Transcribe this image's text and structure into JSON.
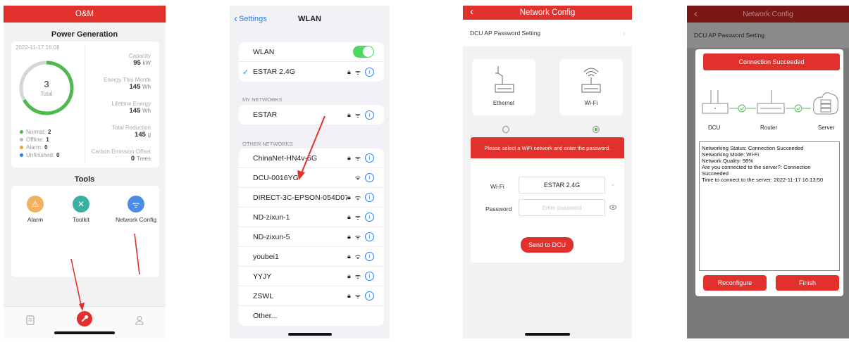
{
  "colors": {
    "accent": "#e2302c",
    "green": "#4cbb4c",
    "blue": "#2a7ef0"
  },
  "screen1": {
    "header": "O&M",
    "power_title": "Power Generation",
    "timestamp": "2022-11-17 16:08",
    "donut": {
      "value": "3",
      "label": "Total",
      "normal_fraction": 0.67
    },
    "stats": [
      {
        "label": "Capacity",
        "value": "95",
        "unit": "kW"
      },
      {
        "label": "Energy This Month",
        "value": "145",
        "unit": "Wh"
      },
      {
        "label": "Lifetime Energy",
        "value": "145",
        "unit": "Wh"
      },
      {
        "label": "Total Reduction",
        "value": "145",
        "unit": "g"
      },
      {
        "label": "Carbon Emission Offset",
        "value": "0",
        "unit": "Trees"
      }
    ],
    "legend": [
      {
        "label": "Normal:",
        "value": "2",
        "color": "#4cbb4c"
      },
      {
        "label": "Offline:",
        "value": "1",
        "color": "#bbbbbb"
      },
      {
        "label": "Alarm:",
        "value": "0",
        "color": "#f0a030"
      },
      {
        "label": "Unfinished:",
        "value": "0",
        "color": "#3a7be0"
      }
    ],
    "tools_title": "Tools",
    "tools": [
      {
        "label": "Alarm",
        "icon": "alarm-icon",
        "color": "#f2b15c"
      },
      {
        "label": "Toolkit",
        "icon": "toolkit-icon",
        "color": "#3ab0a0"
      },
      {
        "label": "Network Config",
        "icon": "network-config-icon",
        "color": "#4a8de6"
      }
    ],
    "tabbar": [
      "report-icon",
      "tools-wrench-icon",
      "profile-icon"
    ]
  },
  "screen2": {
    "back_label": "Settings",
    "title": "WLAN",
    "wlan_label": "WLAN",
    "connected": "ESTAR 2.4G",
    "my_networks_label": "MY NETWORKS",
    "my_networks": [
      "ESTAR"
    ],
    "other_networks_label": "OTHER NETWORKS",
    "other_networks": [
      {
        "name": "ChinaNet-HN4v-5G",
        "locked": true
      },
      {
        "name": "DCU-0016YG",
        "locked": false
      },
      {
        "name": "DIRECT-3C-EPSON-054D07",
        "locked": true
      },
      {
        "name": "ND-zixun-1",
        "locked": true
      },
      {
        "name": "ND-zixun-5",
        "locked": true
      },
      {
        "name": "youbei1",
        "locked": true
      },
      {
        "name": "YYJY",
        "locked": true
      },
      {
        "name": "ZSWL",
        "locked": true
      }
    ],
    "other_label": "Other..."
  },
  "screen3": {
    "title": "Network Config",
    "password_setting": "DCU AP Password Setting",
    "ethernet_label": "Ethernet",
    "wifi_label": "Wi-Fi",
    "notice": "Please select a WiFi network and enter the password.",
    "wifi_field_label": "Wi-Fi",
    "wifi_value": "ESTAR 2.4G",
    "password_label": "Password",
    "password_placeholder": "Enter password",
    "send_button": "Send to DCU"
  },
  "screen4": {
    "title": "Network Config",
    "password_setting": "DCU AP Password Setting",
    "banner": "Connection Succeeded",
    "nodes": [
      "DCU",
      "Router",
      "Server"
    ],
    "log": [
      "Networking Status: Connection Succeeded",
      "Networking Mode: Wi-Fi",
      "Network Quality: 98%",
      "Are you connected to the server?: Connection Succeeded",
      "Time to connect to the server: 2022-11-17 16:13:50"
    ],
    "reconfigure_button": "Reconfigure",
    "finish_button": "Finish"
  }
}
